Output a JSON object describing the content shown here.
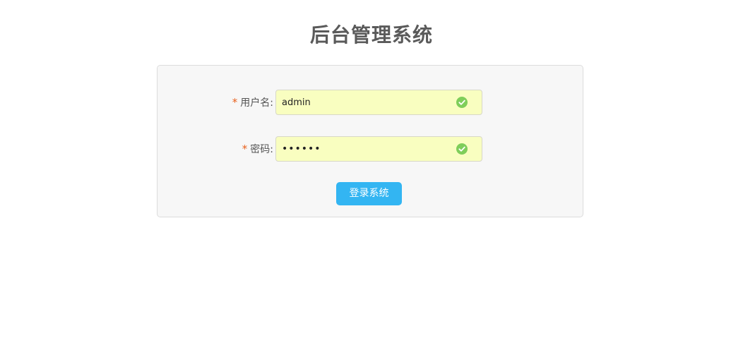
{
  "page": {
    "title": "后台管理系统"
  },
  "form": {
    "username": {
      "required_mark": "*",
      "label": "用户名:",
      "value": "admin",
      "valid": true,
      "icon": "check-circle-icon"
    },
    "password": {
      "required_mark": "*",
      "label": "密码:",
      "value": "••••••",
      "valid": true,
      "icon": "check-circle-icon"
    },
    "submit_label": "登录系统"
  },
  "colors": {
    "accent": "#33b5f2",
    "required": "#e8601c",
    "valid": "#7fce5a",
    "input_autofill_bg": "#f9fec0",
    "card_bg": "#f7f7f7",
    "title": "#5a5a5a"
  }
}
